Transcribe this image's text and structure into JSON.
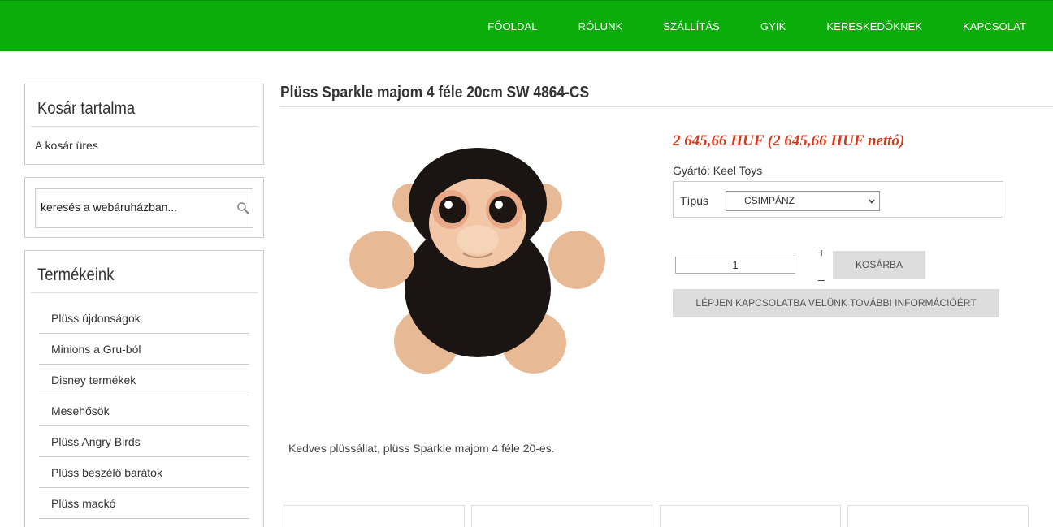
{
  "nav": {
    "items": [
      "FŐOLDAL",
      "RÓLUNK",
      "SZÁLLÍTÁS",
      "GYIK",
      "KERESKEDŐKNEK",
      "KAPCSOLAT"
    ]
  },
  "cart": {
    "title": "Kosár tartalma",
    "empty_text": "A kosár üres"
  },
  "search": {
    "value": "keresés a webáruházban...",
    "icon": "search-icon"
  },
  "products": {
    "title": "Termékeink",
    "categories": [
      "Plüss újdonságok",
      "Minions a Gru-ból",
      "Disney termékek",
      "Mesehősök",
      "Plüss Angry Birds",
      "Plüss beszélő barátok",
      "Plüss mackó"
    ]
  },
  "product": {
    "title": "Plüss Sparkle majom 4 féle 20cm SW 4864-CS",
    "price": "2 645,66 HUF (2 645,66 HUF nettó)",
    "manufacturer": "Gyártó: Keel Toys",
    "type_label": "Típus",
    "type_selected": "CSIMPÁNZ",
    "quantity": "1",
    "plus": "+",
    "minus": "_",
    "add_to_cart": "KOSÁRBA",
    "contact": "LÉPJEN KAPCSOLATBA VELÜNK TOVÁBBI INFORMÁCIÓÉRT",
    "description": "Kedves plüssállat, plüss Sparkle majom 4 féle 20-es."
  },
  "colors": {
    "header_green": "#0aad0a",
    "price_red": "#d33a1e",
    "button_gray": "#dddddd"
  }
}
